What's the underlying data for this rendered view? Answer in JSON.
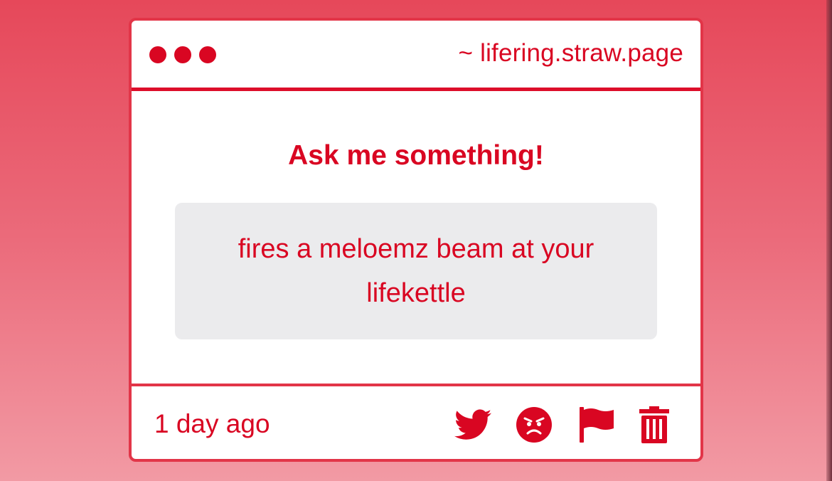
{
  "window": {
    "url": "~ lifering.straw.page"
  },
  "main": {
    "heading": "Ask me something!",
    "question": "fires a meloemz beam at your lifekettle"
  },
  "footer": {
    "timestamp": "1 day ago",
    "actions": [
      {
        "icon": "twitter-bird-icon"
      },
      {
        "icon": "angry-face-icon"
      },
      {
        "icon": "flag-icon"
      },
      {
        "icon": "trash-icon"
      }
    ]
  },
  "colors": {
    "accent": "#d90622",
    "border": "#e23548",
    "question_bg": "#ebebed",
    "background_top": "#e6485a",
    "background_bottom": "#f29aa4"
  }
}
